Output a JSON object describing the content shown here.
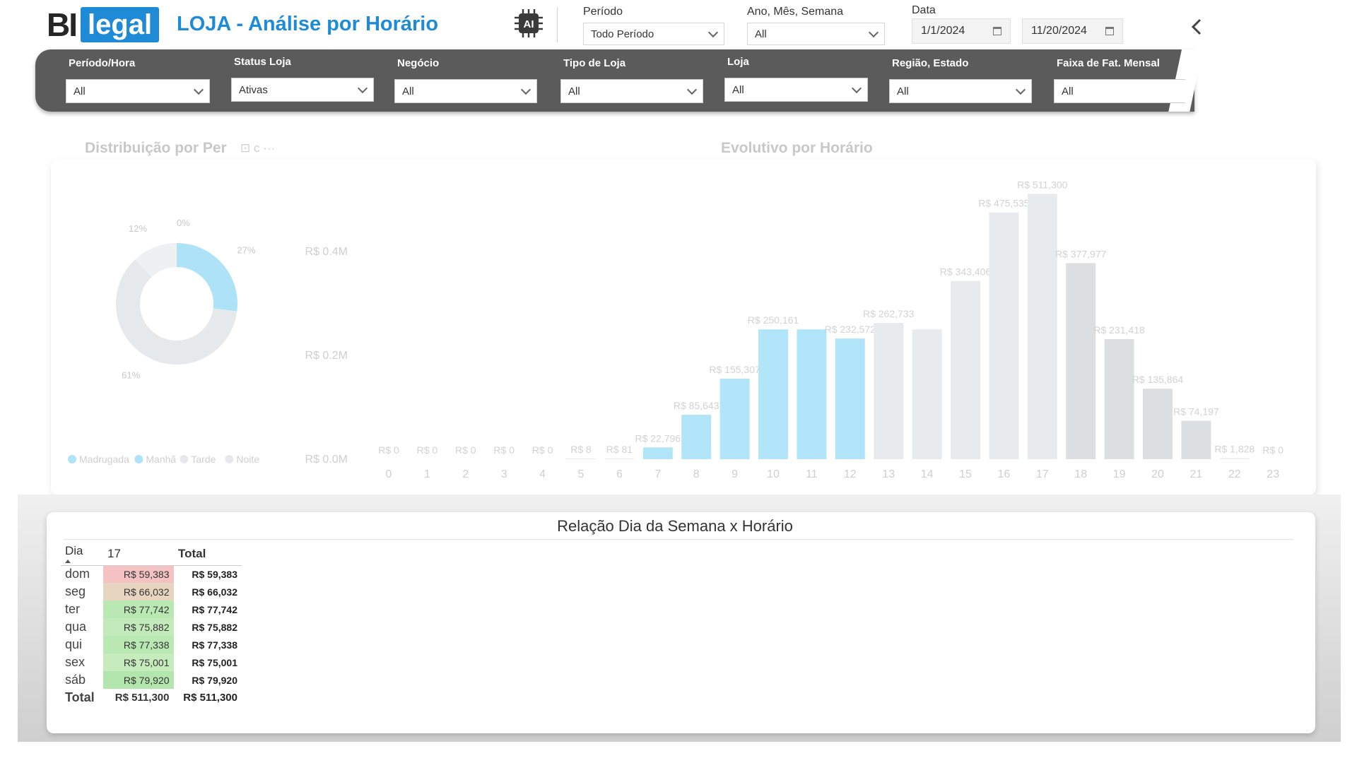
{
  "header": {
    "logo_bi": "BI",
    "logo_legal": "legal",
    "title": "LOJA - Análise por Horário",
    "periodo": {
      "label": "Período",
      "value": "Todo Período"
    },
    "ano_mes_semana": {
      "label": "Ano, Mês, Semana",
      "value": "All"
    },
    "data": {
      "label": "Data",
      "start": "1/1/2024",
      "end": "11/20/2024"
    }
  },
  "filters": [
    {
      "label": "Período/Hora",
      "value": "All"
    },
    {
      "label": "Status Loja",
      "value": "Ativas"
    },
    {
      "label": "Negócio",
      "value": "All"
    },
    {
      "label": "Tipo de Loja",
      "value": "All"
    },
    {
      "label": "Loja",
      "value": "All"
    },
    {
      "label": "Região, Estado",
      "value": "All"
    },
    {
      "label": "Faixa de Fat. Mensal",
      "value": "All"
    }
  ],
  "donut": {
    "title": "Distribuição por Per",
    "title_icons": "⊡ c ···",
    "slices": [
      {
        "name": "Madrugada",
        "pct": 0,
        "label": "0%",
        "color": "#aee3f7"
      },
      {
        "name": "Manhã",
        "pct": 27,
        "label": "27%",
        "color": "#aee3f7"
      },
      {
        "name": "Tarde",
        "pct": 61,
        "label": "61%",
        "color": "#e6e9ec"
      },
      {
        "name": "Noite",
        "pct": 12,
        "label": "12%",
        "color": "#eef0f2"
      }
    ],
    "legend": [
      "Madrugada",
      "Manhã",
      "Tarde",
      "Noite"
    ]
  },
  "chart_data": {
    "type": "bar",
    "title": "Evolutivo por Horário",
    "categories": [
      "0",
      "1",
      "2",
      "3",
      "4",
      "5",
      "6",
      "7",
      "8",
      "9",
      "10",
      "11",
      "12",
      "13",
      "14",
      "15",
      "16",
      "17",
      "18",
      "19",
      "20",
      "21",
      "22",
      "23"
    ],
    "values": [
      0,
      0,
      0,
      0,
      0,
      8,
      81,
      22796,
      85643,
      155307,
      250161,
      250161,
      232572,
      262733,
      250161,
      343406,
      475535,
      511300,
      377977,
      231418,
      135864,
      74197,
      1828,
      0
    ],
    "labels": [
      "R$ 0",
      "R$ 0",
      "R$ 0",
      "R$ 0",
      "R$ 0",
      "R$ 8",
      "R$ 81",
      "R$ 22,796",
      "R$ 85,643",
      "R$ 155,307",
      "R$ 250,161",
      "",
      "R$ 232,572",
      "R$ 262,733",
      "",
      "R$ 343,406",
      "R$ 475,535",
      "R$ 511,300",
      "R$ 377,977",
      "R$ 231,418",
      "R$ 135,864",
      "R$ 74,197",
      "R$ 1,828",
      "R$ 0"
    ],
    "highlight": [
      false,
      false,
      false,
      false,
      false,
      false,
      false,
      true,
      true,
      true,
      true,
      true,
      true,
      false,
      false,
      false,
      false,
      false,
      false,
      false,
      false,
      false,
      false,
      false
    ],
    "colors": {
      "highlight": "#b3e5fa",
      "base": "#e8ebee",
      "dim": "#dcdfe2"
    },
    "y_ticks": [
      {
        "value": 0,
        "label": "R$ 0.0M"
      },
      {
        "value": 200000,
        "label": "R$ 0.2M"
      },
      {
        "value": 400000,
        "label": "R$ 0.4M"
      }
    ],
    "ylim": [
      0,
      520000
    ]
  },
  "matrix": {
    "title": "Relação Dia da Semana x Horário",
    "columns": [
      "Dia",
      "17",
      "Total"
    ],
    "rows": [
      {
        "day": "dom",
        "value": "R$ 59,383",
        "total": "R$ 59,383",
        "color": "#f4c2c2"
      },
      {
        "day": "seg",
        "value": "R$ 66,032",
        "total": "R$ 66,032",
        "color": "#e8d5c0"
      },
      {
        "day": "ter",
        "value": "R$ 77,742",
        "total": "R$ 77,742",
        "color": "#b9e8b3"
      },
      {
        "day": "qua",
        "value": "R$ 75,882",
        "total": "R$ 75,882",
        "color": "#c3eabb"
      },
      {
        "day": "qui",
        "value": "R$ 77,338",
        "total": "R$ 77,338",
        "color": "#b9e8b3"
      },
      {
        "day": "sex",
        "value": "R$ 75,001",
        "total": "R$ 75,001",
        "color": "#c6ebbd"
      },
      {
        "day": "sáb",
        "value": "R$ 79,920",
        "total": "R$ 79,920",
        "color": "#b3e6ad"
      }
    ],
    "total_row": {
      "day": "Total",
      "value": "R$ 511,300",
      "total": "R$ 511,300"
    }
  }
}
